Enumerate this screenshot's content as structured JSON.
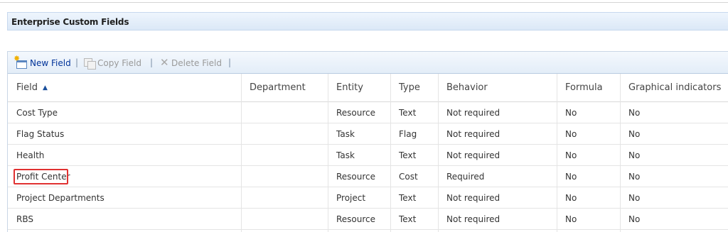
{
  "section": {
    "title": "Enterprise Custom Fields"
  },
  "toolbar": {
    "new_field": "New Field",
    "copy_field": "Copy Field",
    "delete_field": "Delete Field",
    "separator": "|"
  },
  "columns": [
    "Field",
    "Department",
    "Entity",
    "Type",
    "Behavior",
    "Formula",
    "Graphical indicators"
  ],
  "sort": {
    "column": "Field",
    "direction": "ascending"
  },
  "rows": [
    {
      "field": "Cost Type",
      "department": "",
      "entity": "Resource",
      "type": "Text",
      "behavior": "Not required",
      "formula": "No",
      "graphical": "No"
    },
    {
      "field": "Flag Status",
      "department": "",
      "entity": "Task",
      "type": "Flag",
      "behavior": "Not required",
      "formula": "No",
      "graphical": "No"
    },
    {
      "field": "Health",
      "department": "",
      "entity": "Task",
      "type": "Text",
      "behavior": "Not required",
      "formula": "No",
      "graphical": "No"
    },
    {
      "field": "Profit Center",
      "department": "",
      "entity": "Resource",
      "type": "Cost",
      "behavior": "Required",
      "formula": "No",
      "graphical": "No"
    },
    {
      "field": "Project Departments",
      "department": "",
      "entity": "Project",
      "type": "Text",
      "behavior": "Not required",
      "formula": "No",
      "graphical": "No"
    },
    {
      "field": "RBS",
      "department": "",
      "entity": "Resource",
      "type": "Text",
      "behavior": "Not required",
      "formula": "No",
      "graphical": "No"
    }
  ],
  "highlighted_row": "Profit Center",
  "colors": {
    "link": "#003399",
    "highlight": "#e03131",
    "header_bg": "#dbe8f7"
  }
}
